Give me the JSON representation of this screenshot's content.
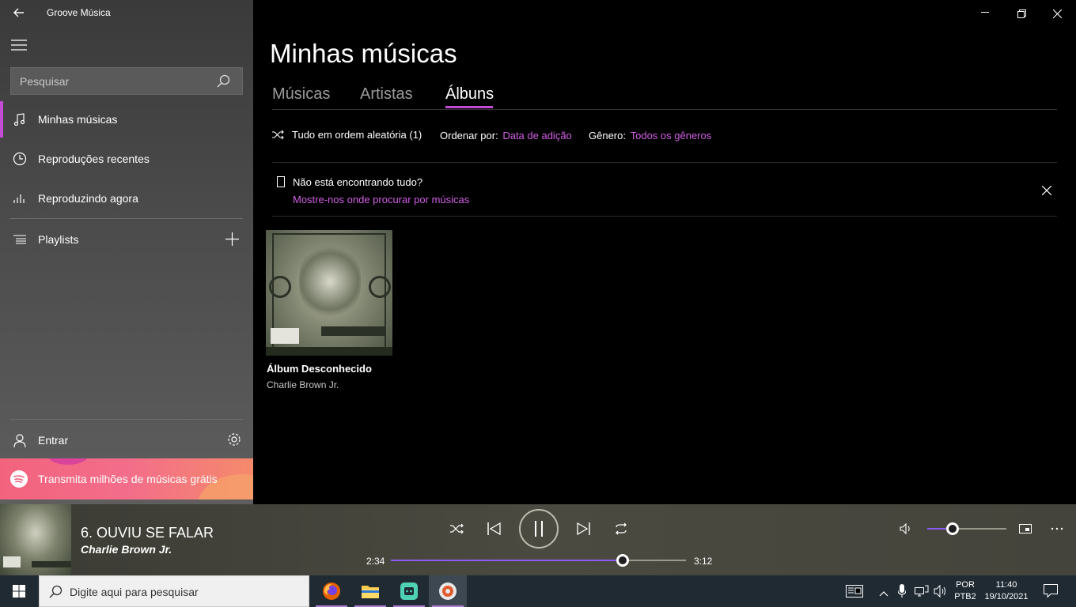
{
  "window": {
    "title": "Groove Música"
  },
  "sidebar": {
    "search_placeholder": "Pesquisar",
    "items": [
      {
        "label": "Minhas músicas",
        "icon": "music-note-icon",
        "selected": true
      },
      {
        "label": "Reproduções recentes",
        "icon": "clock-icon"
      },
      {
        "label": "Reproduzindo agora",
        "icon": "equalizer-icon"
      },
      {
        "label": "Playlists",
        "icon": "playlist-icon"
      }
    ],
    "sign_in_label": "Entrar",
    "promo_label": "Transmita milhões de músicas grátis"
  },
  "main": {
    "title": "Minhas músicas",
    "tabs": [
      {
        "label": "Músicas"
      },
      {
        "label": "Artistas"
      },
      {
        "label": "Álbuns",
        "active": true
      }
    ],
    "toolbar": {
      "shuffle_label": "Tudo em ordem aleatória (1)",
      "sort_label": "Ordenar por:",
      "sort_value": "Data de adição",
      "genre_label": "Gênero:",
      "genre_value": "Todos os gêneros"
    },
    "notice": {
      "title": "Não está encontrando tudo?",
      "link": "Mostre-nos onde procurar por músicas"
    },
    "albums": [
      {
        "title": "Álbum Desconhecido",
        "artist": "Charlie Brown Jr."
      }
    ]
  },
  "player": {
    "track": "6. OUVIU SE FALAR",
    "artist": "Charlie Brown Jr.",
    "elapsed": "2:34",
    "duration": "3:12",
    "progress": 0.786,
    "volume": 0.32
  },
  "taskbar": {
    "search_placeholder": "Digite aqui para pesquisar",
    "lang_top": "POR",
    "lang_bottom": "PTB2",
    "time": "11:40",
    "date": "19/10/2021"
  },
  "colors": {
    "accent": "#c34bd6",
    "link": "#d35ee6",
    "progress": "#8a5cf0"
  }
}
